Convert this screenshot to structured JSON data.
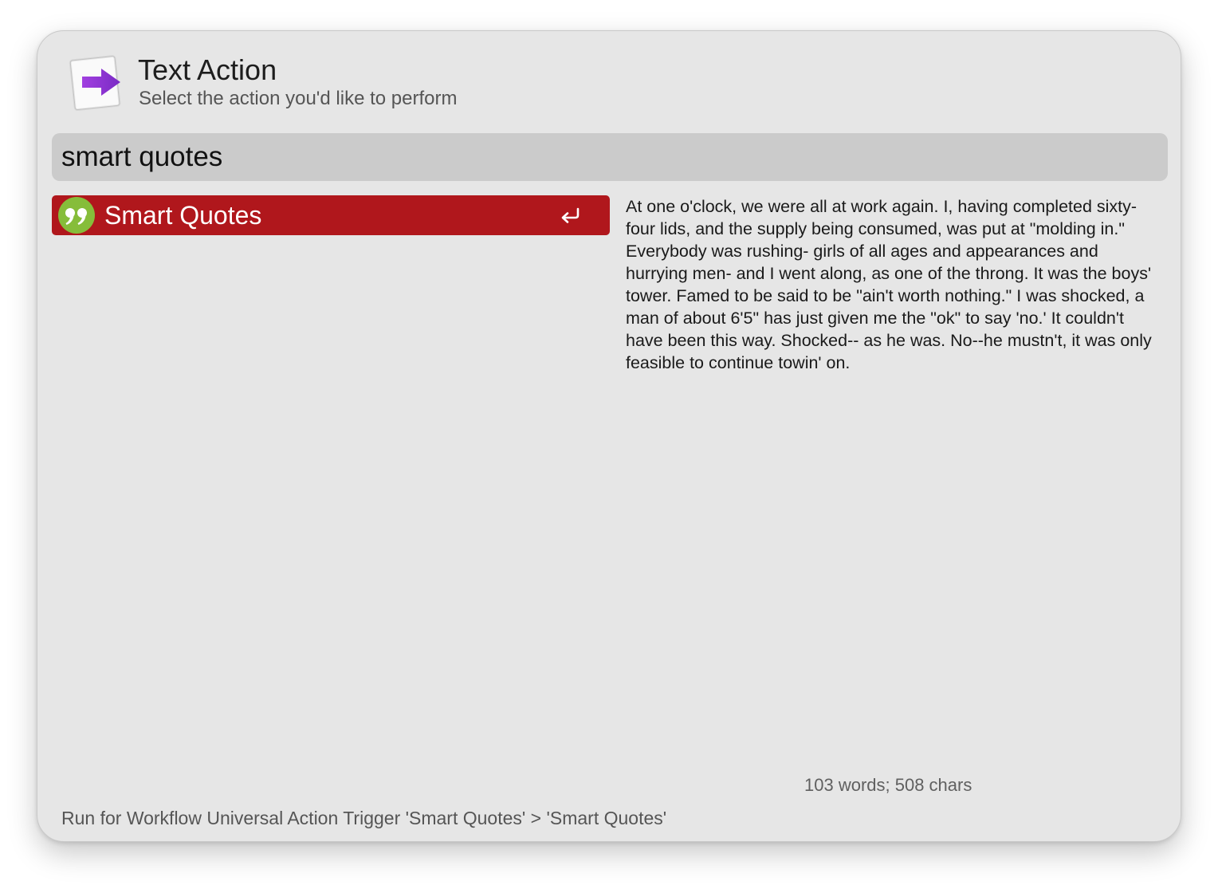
{
  "header": {
    "icon": "text-action-arrow-icon",
    "title": "Text Action",
    "subtitle": "Select the action you'd like to perform"
  },
  "search": {
    "value": "smart quotes",
    "placeholder": ""
  },
  "results": [
    {
      "label": "Smart Quotes",
      "icon": "quote-marks-icon",
      "shortcut_icon": "return-key-icon",
      "selected": true
    }
  ],
  "preview": {
    "text": "At one o'clock, we were all at work again. I, having completed sixty-four lids, and the supply being consumed, was put at \"molding in.\" Everybody was rushing- girls of all ages and appearances and hurrying men- and I went along, as one of the throng. It was the boys' tower. Famed to be said to be \"ain't worth nothing.\" I was shocked, a man of about 6'5\" has just given me the \"ok\" to say 'no.' It couldn't have been this way. Shocked-- as he was. No--he mustn't, it was only feasible to continue towin' on.",
    "stats": "103 words; 508 chars"
  },
  "footer": {
    "status": "Run for Workflow Universal Action Trigger 'Smart Quotes' > 'Smart Quotes'"
  },
  "colors": {
    "window_bg": "#e6e6e6",
    "search_bg": "#cbcbcb",
    "selected_row": "#b0171c",
    "quote_icon_bg": "#86bd3a",
    "arrow_purple": "#8b2fd0"
  }
}
